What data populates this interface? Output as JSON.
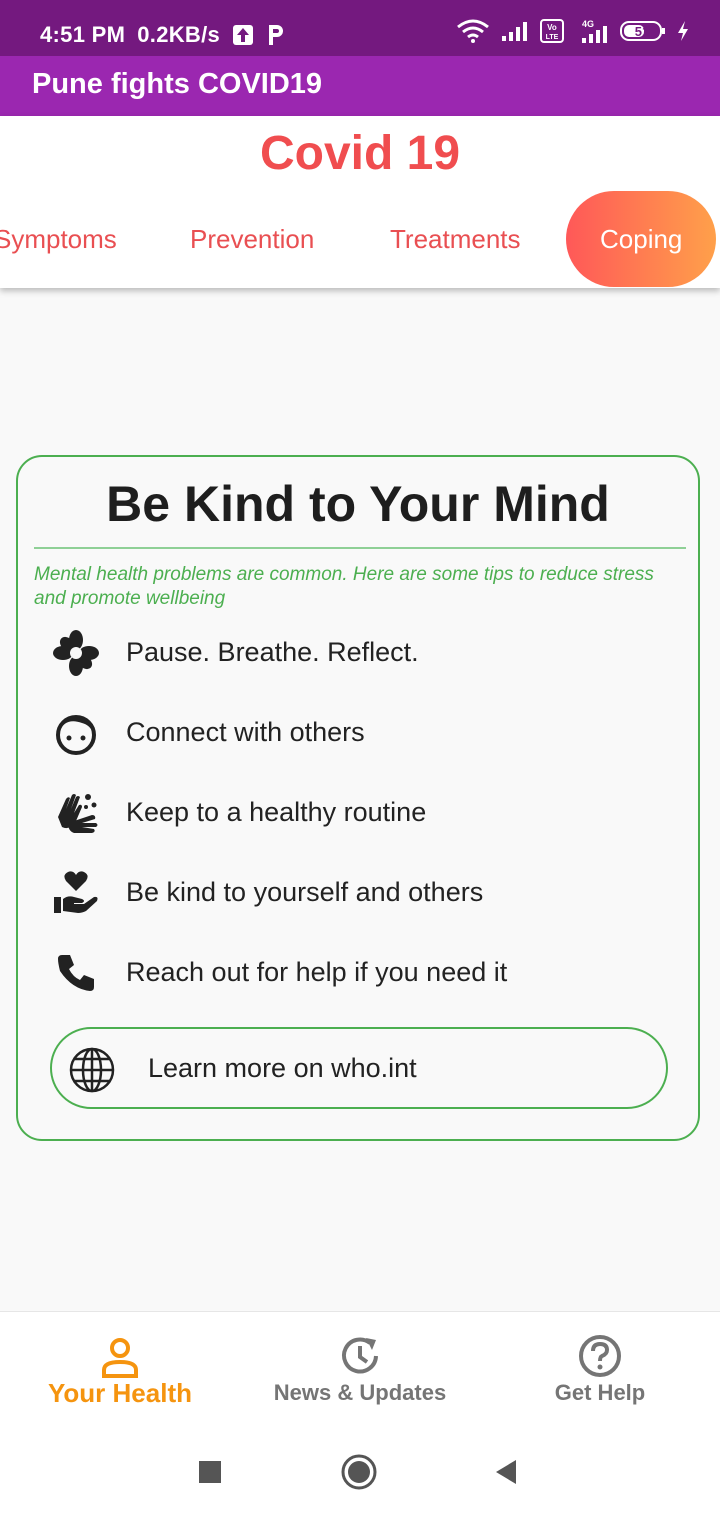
{
  "status_bar": {
    "time": "4:51 PM",
    "speed": "0.2KB/s",
    "battery": "51",
    "icons": [
      "upload-icon",
      "parking-icon",
      "wifi-icon",
      "signal-icon",
      "volte-icon",
      "4g-signal-icon",
      "battery-icon",
      "charging-icon"
    ]
  },
  "app_bar": {
    "title": "Pune fights COVID19"
  },
  "header": {
    "title": "Covid 19",
    "tabs": [
      {
        "label": "Symptoms"
      },
      {
        "label": "Prevention"
      },
      {
        "label": "Treatments"
      },
      {
        "label": "Coping"
      }
    ],
    "active_tab": "Coping"
  },
  "card": {
    "title": "Be Kind to Your Mind",
    "subtitle": "Mental health problems are common. Here are some tips to reduce stress and promote wellbeing",
    "tips": [
      {
        "icon": "flower-icon",
        "text": "Pause. Breathe. Reflect."
      },
      {
        "icon": "face-icon",
        "text": "Connect with others"
      },
      {
        "icon": "hands-wash-icon",
        "text": "Keep to a healthy routine"
      },
      {
        "icon": "heart-hand-icon",
        "text": "Be kind to yourself and others"
      },
      {
        "icon": "phone-icon",
        "text": "Reach out for help if you need it"
      }
    ],
    "learn_more": {
      "icon": "globe-icon",
      "label": "Learn more on who.int"
    }
  },
  "bottom_nav": [
    {
      "label": "Your Health",
      "icon": "person-icon",
      "active": true
    },
    {
      "label": "News & Updates",
      "icon": "history-icon",
      "active": false
    },
    {
      "label": "Get Help",
      "icon": "help-icon",
      "active": false
    }
  ],
  "colors": {
    "status_bar": "#74197f",
    "app_bar": "#9b27b0",
    "accent_red": "#f04d4f",
    "green": "#4caf50",
    "orange": "#f5940f"
  }
}
